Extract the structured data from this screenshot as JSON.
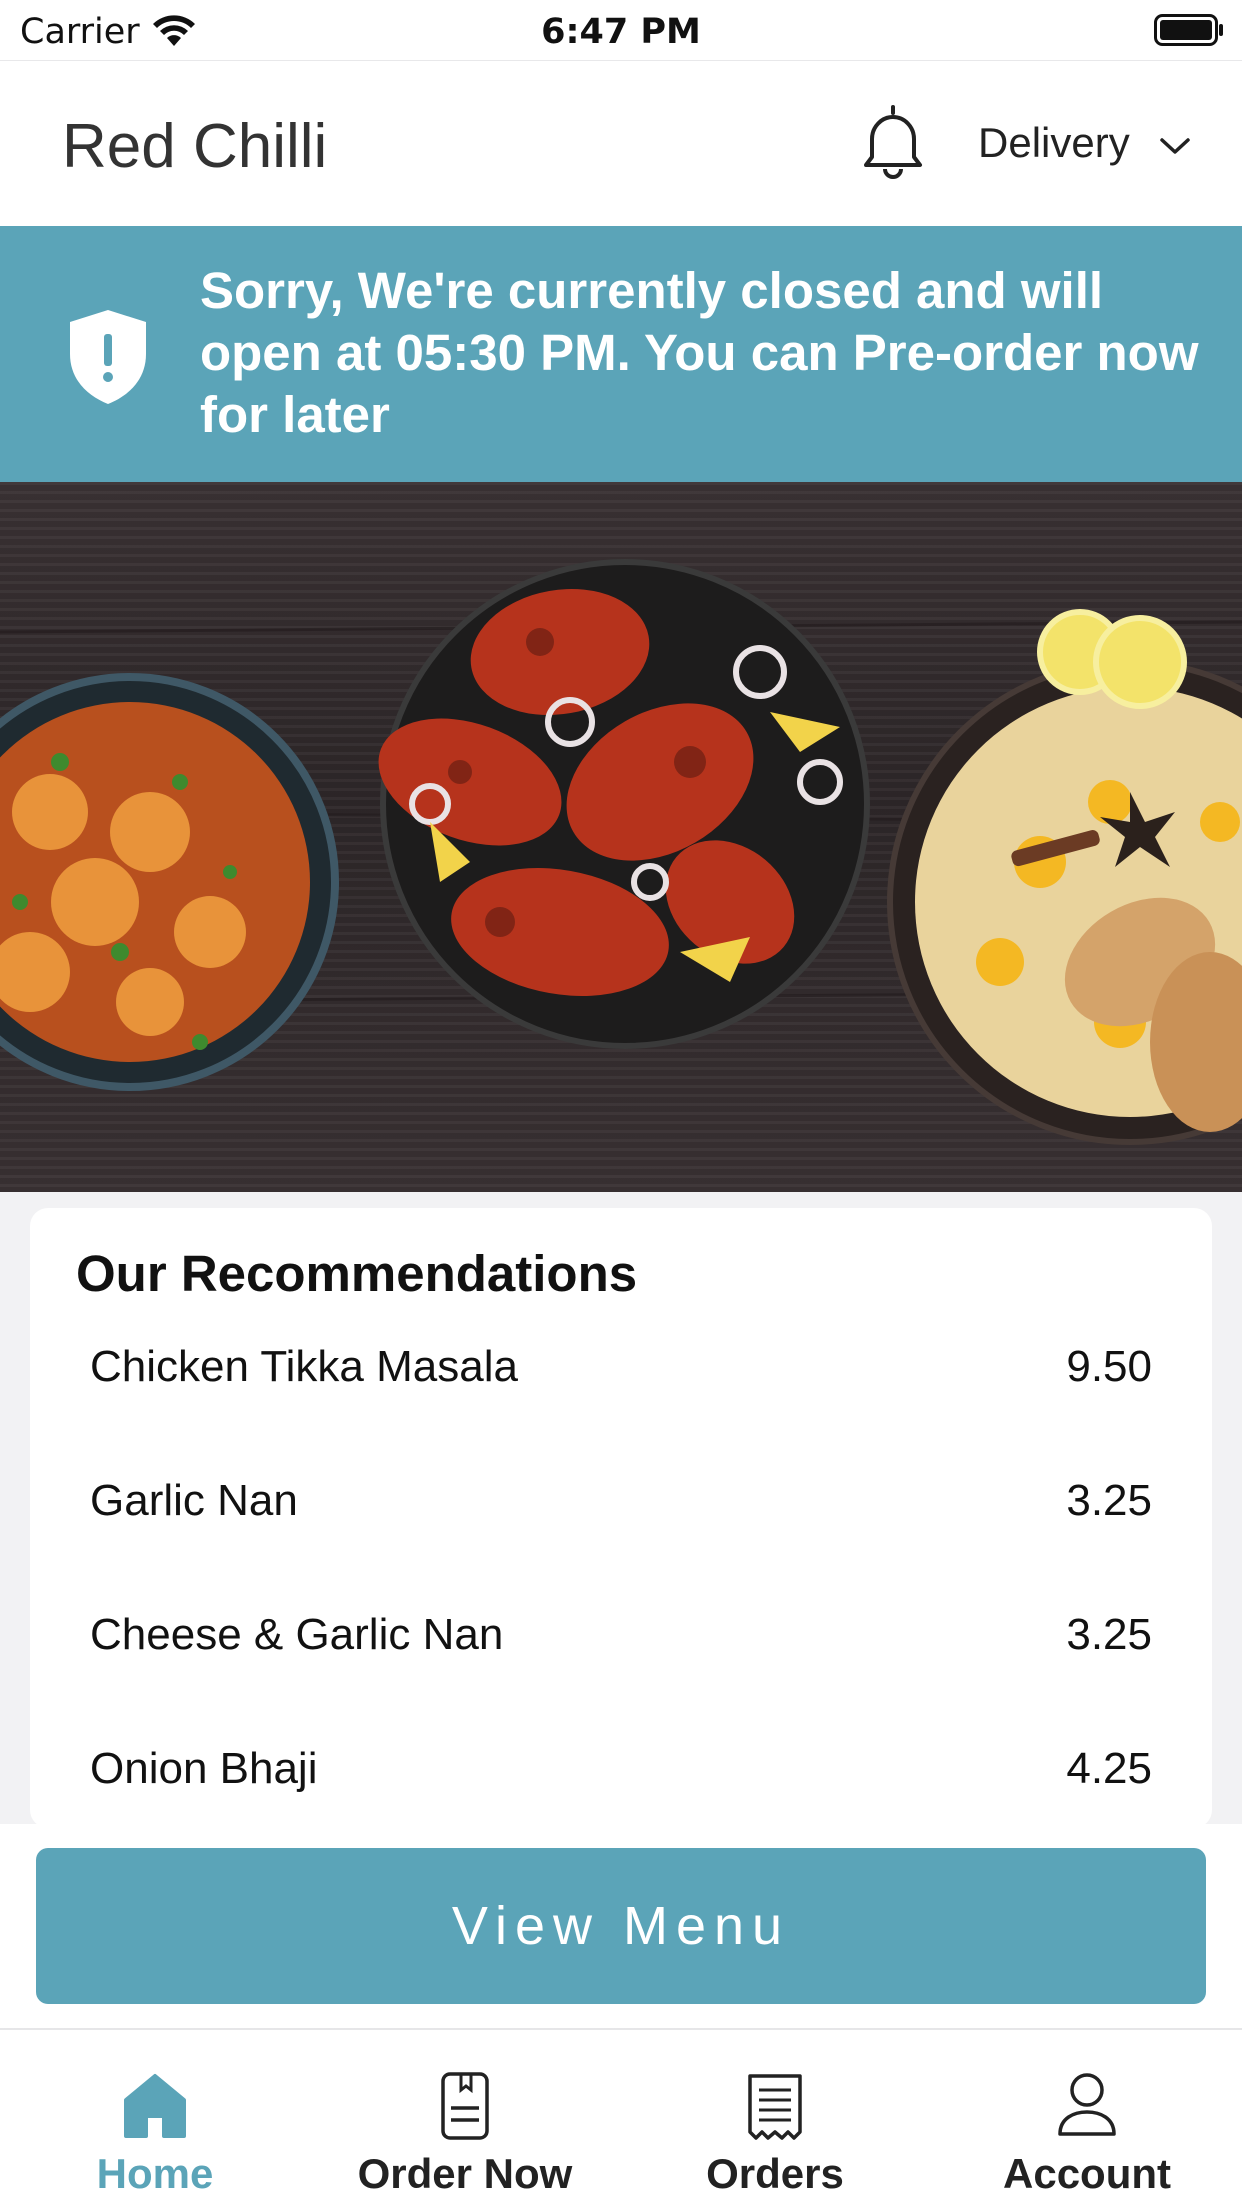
{
  "status_bar": {
    "carrier": "Carrier",
    "time": "6:47 PM"
  },
  "header": {
    "title": "Red Chilli",
    "mode_label": "Delivery"
  },
  "banner": {
    "message": "Sorry, We're currently closed and will open at 05:30 PM. You can Pre-order now for later"
  },
  "recommendations": {
    "title": "Our Recommendations",
    "items": [
      {
        "name": "Chicken Tikka Masala",
        "price": "9.50"
      },
      {
        "name": "Garlic Nan",
        "price": "3.25"
      },
      {
        "name": "Cheese & Garlic Nan",
        "price": "3.25"
      },
      {
        "name": "Onion Bhaji",
        "price": "4.25"
      }
    ]
  },
  "view_menu_label": "View Menu",
  "tabs": [
    {
      "label": "Home",
      "icon": "home-icon",
      "active": true
    },
    {
      "label": "Order Now",
      "icon": "menu-book-icon",
      "active": false
    },
    {
      "label": "Orders",
      "icon": "receipt-icon",
      "active": false
    },
    {
      "label": "Account",
      "icon": "user-icon",
      "active": false
    }
  ],
  "colors": {
    "accent": "#5ba4b8",
    "text": "#111111",
    "background": "#f2f2f4"
  }
}
